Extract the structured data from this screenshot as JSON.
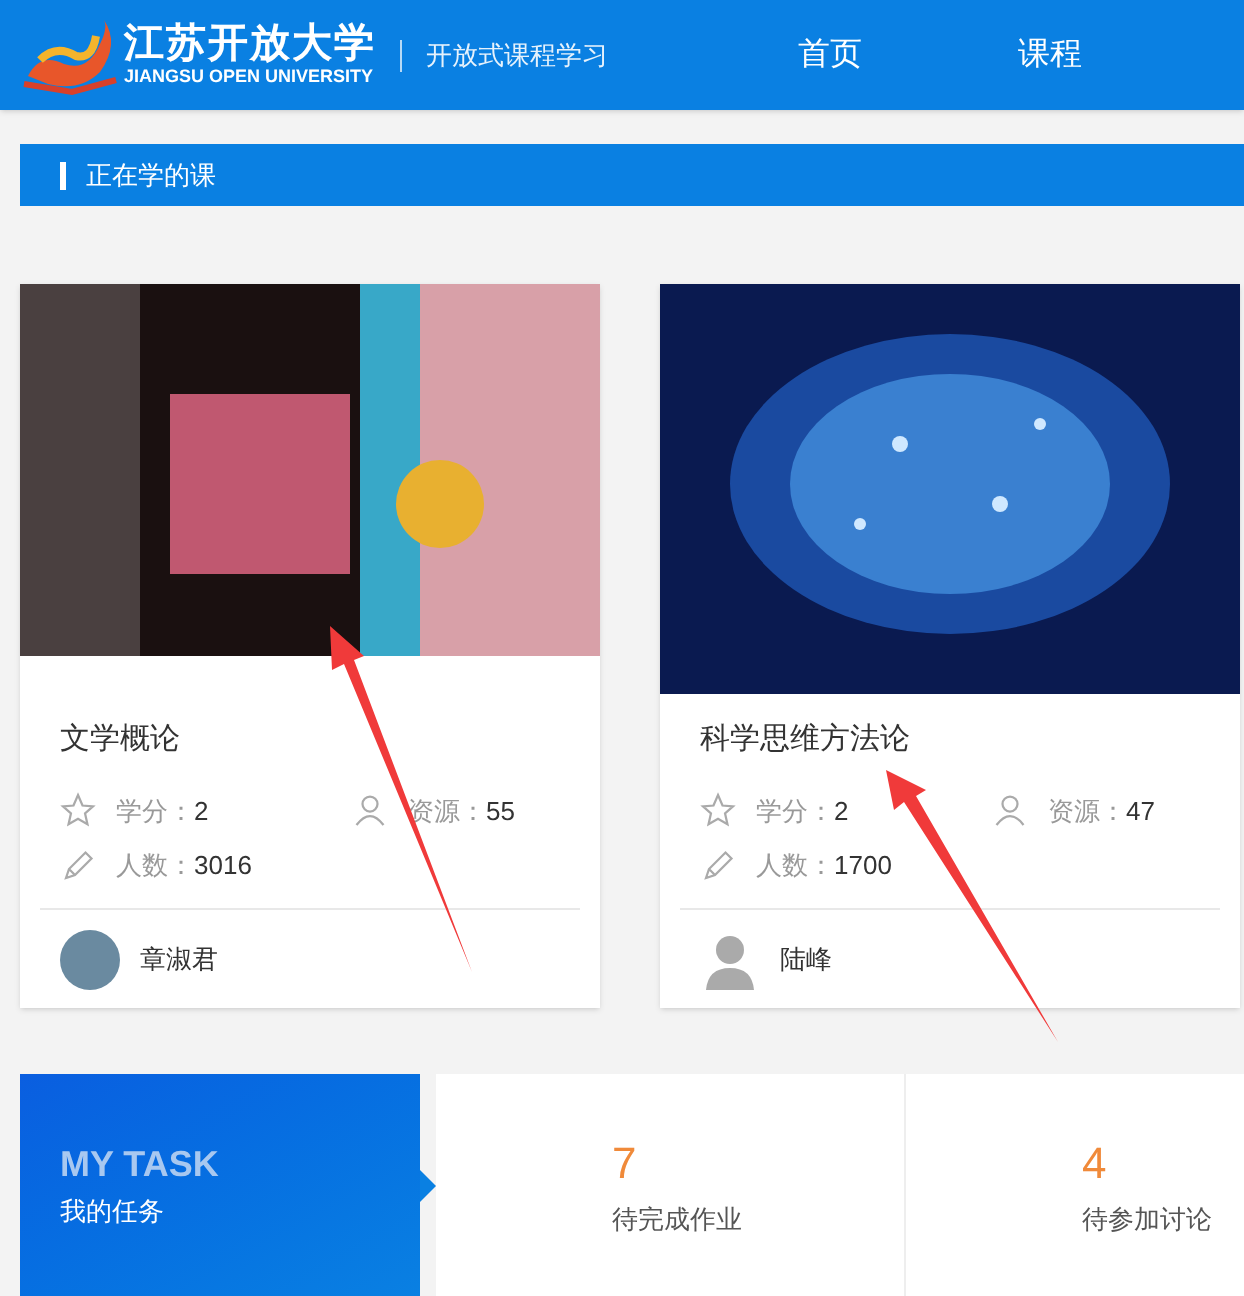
{
  "header": {
    "logo_name": "江苏开放大学",
    "logo_subtitle": "JIANGSU OPEN UNIVERSITY",
    "tagline": "开放式课程学习",
    "nav": [
      {
        "label": "首页"
      },
      {
        "label": "课程"
      }
    ]
  },
  "section": {
    "title": "正在学的课"
  },
  "courses": [
    {
      "title": "文学概论",
      "credit_label": "学分：",
      "credit": "2",
      "resource_label": "资源：",
      "resources": "55",
      "people_label": "人数：",
      "people": "3016",
      "teacher": "章淑君"
    },
    {
      "title": "科学思维方法论",
      "credit_label": "学分：",
      "credit": "2",
      "resource_label": "资源：",
      "resources": "47",
      "people_label": "人数：",
      "people": "1700",
      "teacher": "陆峰"
    }
  ],
  "tasks": {
    "title_en": "MY TASK",
    "title": "我的任务",
    "items": [
      {
        "count": "7",
        "label": "待完成作业"
      },
      {
        "count": "4",
        "label": "待参加讨论"
      }
    ]
  }
}
